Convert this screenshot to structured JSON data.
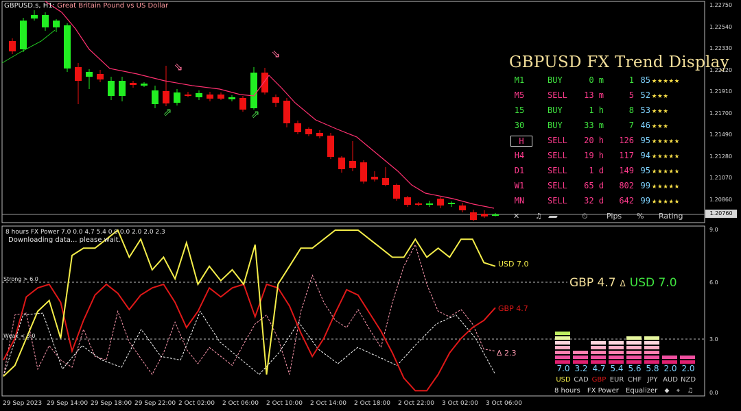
{
  "chart": {
    "symbol_line": "GBPUSD.s, H1:",
    "symbol_desc": "Great Britain Pound vs US Dollar",
    "current_price": "1.20760",
    "price_ticks": [
      "1.22750",
      "1.22540",
      "1.22330",
      "1.22120",
      "1.21910",
      "1.21700",
      "1.21490",
      "1.21280",
      "1.21070",
      "1.20860"
    ],
    "date_ticks": [
      "29 Sep 2023",
      "29 Sep 14:00",
      "29 Sep 18:00",
      "29 Sep 22:00",
      "2 Oct 02:00",
      "2 Oct 06:00",
      "2 Oct 10:00",
      "2 Oct 14:00",
      "2 Oct 18:00",
      "2 Oct 22:00",
      "3 Oct 02:00",
      "3 Oct 06:00"
    ],
    "colors": {
      "bull": "#22ee22",
      "bear": "#ee1111",
      "ma": "#ff3070",
      "arrow_up": "#44cc44",
      "arrow_down": "#ff6f9a"
    }
  },
  "trend": {
    "title": "GBPUSD FX Trend Display",
    "rows": [
      {
        "tf": "M1",
        "signal": "BUY",
        "dur": "0 m",
        "pips": "1",
        "pct": "85",
        "stars": "★★★★★",
        "color": "#3fe33f",
        "boxed": false
      },
      {
        "tf": "M5",
        "signal": "SELL",
        "dur": "13 m",
        "pips": "5",
        "pct": "52",
        "stars": "★★★",
        "color": "#ff3b8d",
        "boxed": false
      },
      {
        "tf": "15",
        "signal": "BUY",
        "dur": "1 h",
        "pips": "8",
        "pct": "53",
        "stars": "★★★",
        "color": "#3fe33f",
        "boxed": false
      },
      {
        "tf": "30",
        "signal": "BUY",
        "dur": "33 m",
        "pips": "7",
        "pct": "46",
        "stars": "★★★",
        "color": "#3fe33f",
        "boxed": false
      },
      {
        "tf": "H",
        "signal": "SELL",
        "dur": "20 h",
        "pips": "126",
        "pct": "95",
        "stars": "★★★★★",
        "color": "#ff3b8d",
        "boxed": true
      },
      {
        "tf": "H4",
        "signal": "SELL",
        "dur": "19 h",
        "pips": "117",
        "pct": "94",
        "stars": "★★★★★",
        "color": "#ff3b8d",
        "boxed": false
      },
      {
        "tf": "D1",
        "signal": "SELL",
        "dur": "1 d",
        "pips": "149",
        "pct": "95",
        "stars": "★★★★★",
        "color": "#ff3b8d",
        "boxed": false
      },
      {
        "tf": "W1",
        "signal": "SELL",
        "dur": "65 d",
        "pips": "802",
        "pct": "99",
        "stars": "★★★★★",
        "color": "#ff3b8d",
        "boxed": false
      },
      {
        "tf": "MN",
        "signal": "SELL",
        "dur": "32 d",
        "pips": "642",
        "pct": "99",
        "stars": "★★★★★",
        "color": "#ff3b8d",
        "boxed": false
      }
    ],
    "pct_color": "#7fd3ff",
    "footer": {
      "close": "✕",
      "sound": "♫",
      "clock": "⏲",
      "pips": "Pips",
      "pct": "%",
      "rating": "Rating"
    }
  },
  "indicator": {
    "title": "8 hours FX Power 7.0 0.0 4.7 5.4 0.0 0.0 2.0 2.0 2.3",
    "message": "Downloading data... please wait.",
    "strong_label": "Strong > 6.0",
    "weak_label": "Weak < 3.0",
    "ticks": [
      "9.0",
      "6.0",
      "3.0",
      "0.0"
    ],
    "usd_label": "USD 7.0",
    "gbp_label": "GBP 4.7",
    "delta_label": "Δ 2.3",
    "head": {
      "gbp": "GBP 4.7",
      "delta": "Δ",
      "usd": "USD 7.0"
    },
    "colors": {
      "usd": "#f5ee4a",
      "gbp": "#e01818",
      "delta": "#ff9ab0"
    }
  },
  "chart_data": {
    "type": "line",
    "title": "8 hours FX Power 7.0 0.0 4.7 5.4 0.0 0.0 2.0 2.0 2.3",
    "ylim": [
      0,
      9
    ],
    "series": [
      {
        "name": "USD 7.0",
        "values": [
          0.9,
          1.5,
          3.0,
          4.5,
          5.1,
          3.0,
          7.6,
          8.0,
          8.0,
          8.5,
          9.0,
          7.5,
          8.5,
          6.8,
          7.5,
          6.3,
          8.3,
          6.0,
          7.0,
          6.2,
          6.8,
          6.0,
          8.2,
          1.0,
          6.0,
          7.0,
          8.0,
          8.0,
          8.5,
          9.0,
          9.0,
          9.0,
          8.5,
          8.0,
          7.5,
          7.5,
          8.5,
          7.5,
          8.0,
          7.5,
          8.5,
          8.5,
          7.2,
          7.0
        ]
      },
      {
        "name": "GBP 4.7",
        "values": [
          1.8,
          3.0,
          5.3,
          5.8,
          6.0,
          5.0,
          2.3,
          4.0,
          5.4,
          6.0,
          5.5,
          4.6,
          5.4,
          5.8,
          6.0,
          5.0,
          3.6,
          4.5,
          5.8,
          5.3,
          5.8,
          6.0,
          4.2,
          6.0,
          5.8,
          4.8,
          3.3,
          2.0,
          3.0,
          4.4,
          5.7,
          5.4,
          4.4,
          3.4,
          2.2,
          0.8,
          0.1,
          0.1,
          1.0,
          2.2,
          3.0,
          3.6,
          4.0,
          4.7
        ]
      },
      {
        "name": "Δ 2.3",
        "values": [
          0.9,
          4.3,
          4.4,
          1.3,
          2.6,
          1.8,
          1.4,
          3.5,
          2.0,
          1.8,
          4.5,
          2.8,
          1.9,
          1.0,
          2.2,
          3.9,
          2.4,
          1.6,
          2.5,
          2.0,
          1.5,
          2.7,
          3.8,
          4.3,
          3.0,
          1.0,
          4.5,
          6.5,
          5.0,
          4.0,
          3.6,
          4.6,
          3.5,
          2.5,
          5.0,
          7.0,
          8.2,
          6.0,
          4.5,
          4.2,
          4.6,
          3.8,
          2.4,
          2.3
        ]
      }
    ]
  },
  "equalizer": {
    "values": [
      "7.0",
      "3.2",
      "4.7",
      "5.4",
      "5.6",
      "5.8",
      "2.0",
      "2.0"
    ],
    "currencies": [
      "USD",
      "CAD",
      "GBP",
      "EUR",
      "CHF",
      "JPY",
      "AUD",
      "NZD"
    ],
    "currency_colors": [
      "#f5ee4a",
      "#c8c8c8",
      "#e01818",
      "#c8c8c8",
      "#c8c8c8",
      "#c8c8c8",
      "#c8c8c8",
      "#c8c8c8"
    ],
    "levels": [
      7.0,
      3.2,
      4.7,
      5.4,
      5.6,
      5.8,
      2.0,
      2.0
    ],
    "footer": [
      "8 hours",
      "FX Power",
      "Equalizer",
      "⬥",
      "⌖",
      "♫"
    ]
  }
}
